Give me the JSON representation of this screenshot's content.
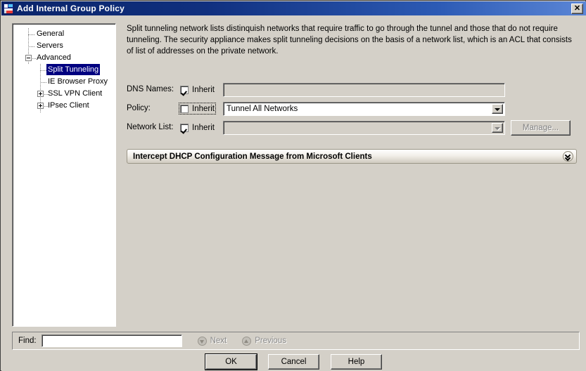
{
  "window": {
    "title": "Add Internal Group Policy",
    "icon": "app-icon",
    "close_label": "✕"
  },
  "tree": {
    "nodes": [
      {
        "label": "General",
        "level": 1,
        "expander": "none"
      },
      {
        "label": "Servers",
        "level": 1,
        "expander": "none"
      },
      {
        "label": "Advanced",
        "level": 1,
        "expander": "minus"
      },
      {
        "label": "Split Tunneling",
        "level": 2,
        "expander": "none",
        "selected": true
      },
      {
        "label": "IE Browser Proxy",
        "level": 2,
        "expander": "none"
      },
      {
        "label": "SSL VPN Client",
        "level": 2,
        "expander": "plus"
      },
      {
        "label": "IPsec Client",
        "level": 2,
        "expander": "plus"
      }
    ]
  },
  "content": {
    "description": "Split tunneling network lists distinquish networks that require traffic to go through the tunnel and those that do not require tunneling. The security appliance makes split tunneling decisions on the basis of a network list, which is an ACL that consists of list of addresses on the private network.",
    "rows": {
      "dns_names": {
        "label": "DNS Names:",
        "inherit_label": "Inherit",
        "inherit_checked": true,
        "value": "",
        "enabled": false
      },
      "policy": {
        "label": "Policy:",
        "inherit_label": "Inherit",
        "inherit_checked": false,
        "value": "Tunnel All Networks",
        "enabled": true,
        "options": [
          "Tunnel All Networks"
        ]
      },
      "network_list": {
        "label": "Network List:",
        "inherit_label": "Inherit",
        "inherit_checked": true,
        "value": "",
        "enabled": false,
        "manage_label": "Manage..."
      }
    },
    "section": {
      "title": "Intercept DHCP Configuration Message from Microsoft Clients",
      "expand_icon": "double-chevron-down-icon",
      "expanded": false
    }
  },
  "findbar": {
    "label": "Find:",
    "value": "",
    "placeholder": "",
    "next_label": "Next",
    "previous_label": "Previous",
    "next_icon": "arrow-down-circle-icon",
    "previous_icon": "arrow-up-circle-icon"
  },
  "buttons": {
    "ok": "OK",
    "cancel": "Cancel",
    "help": "Help"
  },
  "colors": {
    "window_background": "#d4d0c8",
    "titlebar_start": "#0a246a",
    "titlebar_end": "#5b86d6",
    "selection": "#000080",
    "field_background": "#ffffff",
    "disabled_text": "#808080"
  }
}
